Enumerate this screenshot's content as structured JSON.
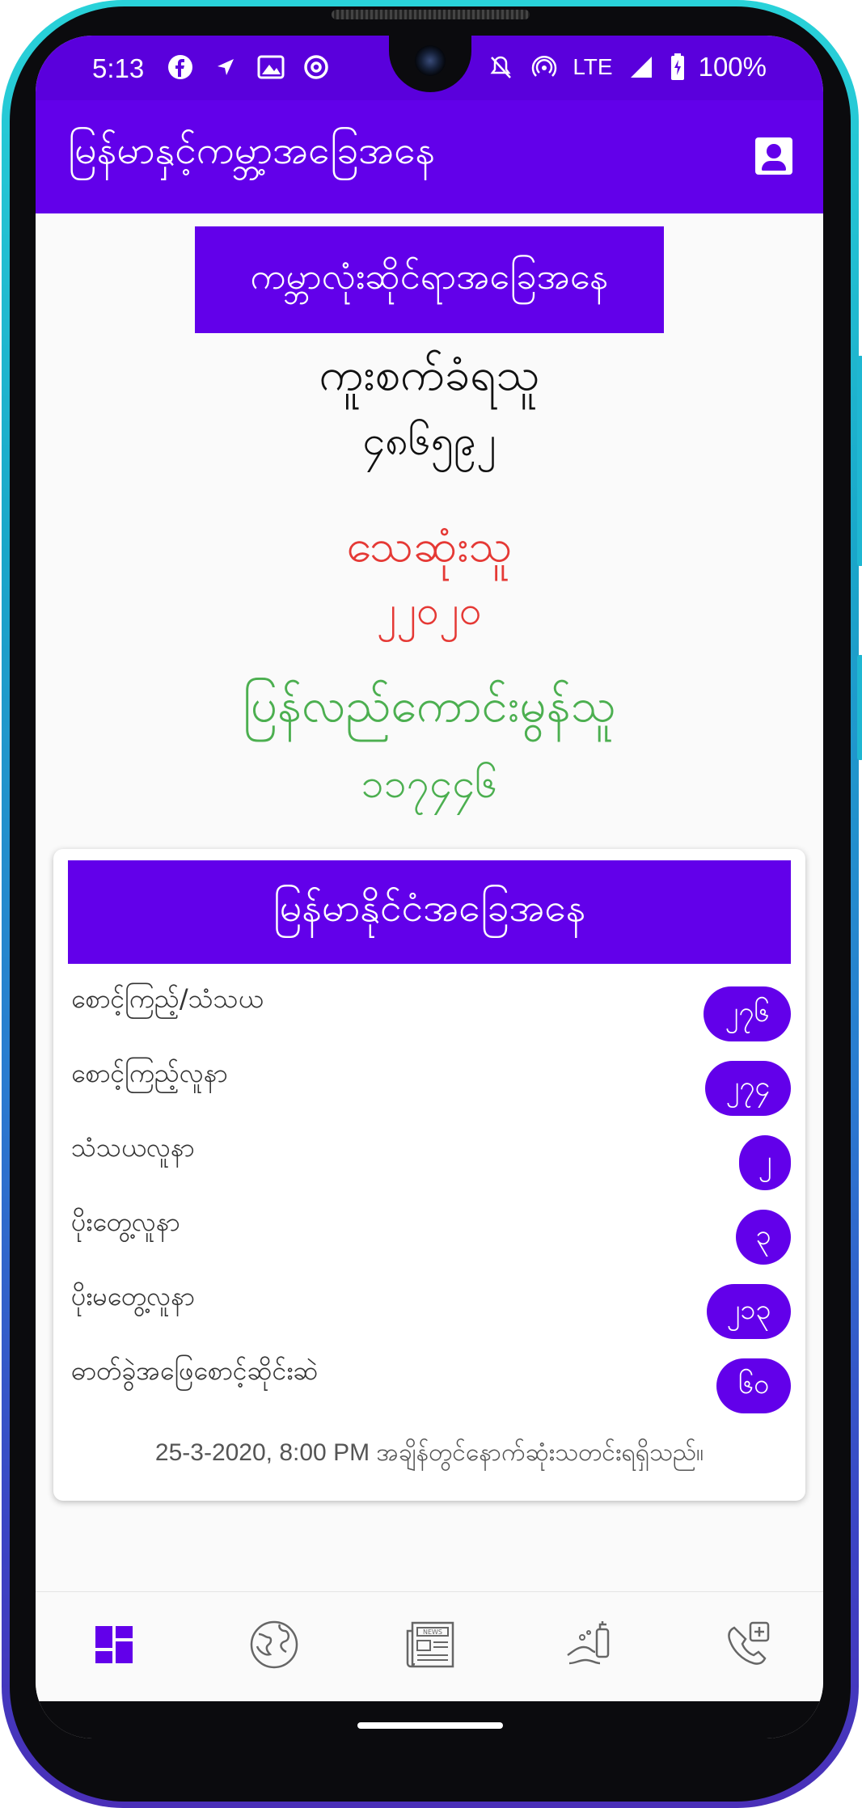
{
  "status_bar": {
    "time": "5:13",
    "network": "LTE",
    "battery": "100%",
    "icons_left": [
      "facebook-icon",
      "navigation-icon",
      "image-icon",
      "at-sign-icon"
    ],
    "icons_right": [
      "mute-icon",
      "hotspot-icon",
      "signal-icon",
      "battery-icon"
    ]
  },
  "app_bar": {
    "title": "မြန်မာနှင့်ကမ္ဘာ့အခြေအနေ",
    "action_icon": "account-box-icon"
  },
  "global": {
    "header": "ကမ္ဘာလုံးဆိုင်ရာအခြေအနေ",
    "confirmed_label": "ကူးစက်ခံရသူ",
    "confirmed_value": "၄၈၆၅၉၂",
    "deaths_label": "သေဆုံးသူ",
    "deaths_value": "၂၂၀၂၀",
    "recovered_label": "ပြန်လည်ကောင်းမွန်သူ",
    "recovered_value": "၁၁၇၄၄၆"
  },
  "myanmar": {
    "header": "မြန်မာနိုင်ငံအခြေအနေ",
    "rows": [
      {
        "label": "စောင့်ကြည့်/သံသယ",
        "value": "၂၇၆"
      },
      {
        "label": "စောင့်ကြည့်လူနာ",
        "value": "၂၇၄"
      },
      {
        "label": "သံသယလူနာ",
        "value": "၂"
      },
      {
        "label": "ပိုးတွေ့လူနာ",
        "value": "၃"
      },
      {
        "label": "ပိုးမတွေ့လူနာ",
        "value": "၂၁၃"
      },
      {
        "label": "ဓာတ်ခွဲအဖြေစောင့်ဆိုင်းဆဲ",
        "value": "၆၀"
      }
    ],
    "footer": "25-3-2020, 8:00 PM အချိန်တွင်နောက်ဆုံးသတင်းရရှိသည်။"
  },
  "bottom_nav": {
    "items": [
      "dashboard-icon",
      "globe-icon",
      "news-icon",
      "handwash-icon",
      "medical-call-icon"
    ],
    "active": "dashboard-icon"
  },
  "colors": {
    "primary": "#6200ea",
    "deaths": "#e53935",
    "recovered": "#4caf50"
  }
}
